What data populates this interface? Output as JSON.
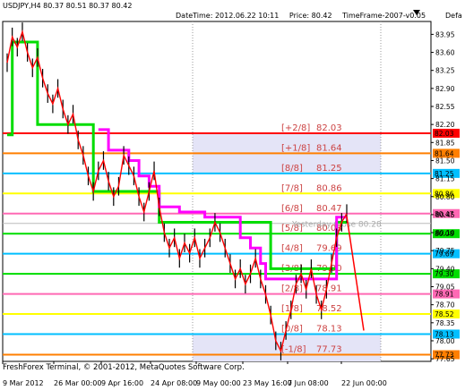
{
  "window": {
    "symbol_line": "USDJPY,H4  80.37 80.51 80.37 80.42",
    "datetime": "DateTime: 2012.06.22 10:11",
    "price": "Price: 80.42",
    "timeframe": "TimeFrame-2007-v0.05",
    "default_label": "Defa",
    "copyright": "FreshForex Terminal, © 2001-2012, MetaQuotes Software Corp."
  },
  "colors": {
    "background": "#ffffff",
    "price_line": "#000000",
    "trend_line": "#ff0000",
    "envelope_green": "#00dd00",
    "envelope_magenta": "#ff00ff",
    "zone_fill": "#e4e4f7"
  },
  "chart_data": {
    "type": "line",
    "ylim": [
      77.6,
      84.2
    ],
    "price_axis_ticks": [
      "83.95",
      "83.60",
      "83.25",
      "82.90",
      "82.55",
      "82.20",
      "81.85",
      "81.50",
      "81.15",
      "80.80",
      "80.45",
      "80.10",
      "79.75",
      "79.40",
      "79.05",
      "78.70",
      "78.35",
      "78.00",
      "77.65"
    ],
    "x_tick_labels": [
      "9 Mar 2012",
      "26 Mar 00:00",
      "9 Apr 16:00",
      "24 Apr 08:00",
      "9 May 00:00",
      "23 May 16:00",
      "7 Jun 08:00",
      "22 Jun 00:00"
    ],
    "murrey_levels": [
      {
        "label": "[+2/8]",
        "value": "82.03",
        "color": "#ff0000",
        "badge_text": "82.03"
      },
      {
        "label": "[+1/8]",
        "value": "81.64",
        "color": "#ff7f00",
        "badge_text": "81.64"
      },
      {
        "label": "[8/8]",
        "value": "81.25",
        "color": "#00bfff",
        "badge_text": "81.25"
      },
      {
        "label": "[7/8]",
        "value": "80.86",
        "color": "#ffff00",
        "badge_text": "80.86"
      },
      {
        "label": "[6/8]",
        "value": "80.47",
        "color": "#ff69b4",
        "badge_text": "80.47"
      },
      {
        "label": "[5/8]",
        "value": "80.08",
        "color": "#00dd00",
        "badge_text": "80.08"
      },
      {
        "label": "[4/8]",
        "value": "79.69",
        "color": "#00bfff",
        "badge_text": "79.69"
      },
      {
        "label": "[3/8]",
        "value": "79.30",
        "color": "#00dd00",
        "badge_text": "79.30"
      },
      {
        "label": "[2/8]",
        "value": "78.91",
        "color": "#ff69b4",
        "badge_text": "78.91"
      },
      {
        "label": "[1/8]",
        "value": "78.52",
        "color": "#ffff00",
        "badge_text": "78.52"
      },
      {
        "label": "[0/8]",
        "value": "78.13",
        "color": "#00bfff",
        "badge_text": "78.13"
      },
      {
        "label": "[-1/8]",
        "value": "77.73",
        "color": "#ff7f00",
        "badge_text": "77.73"
      }
    ],
    "yesterday_close": {
      "label": "Yesterday Close",
      "value": "80.28"
    },
    "current_price": 80.42,
    "price_series": [
      83.4,
      83.9,
      83.7,
      84.0,
      83.6,
      83.3,
      83.5,
      83.1,
      82.8,
      82.6,
      82.9,
      82.5,
      82.2,
      82.4,
      81.9,
      81.6,
      81.2,
      80.9,
      81.3,
      81.5,
      81.1,
      80.8,
      81.0,
      81.6,
      81.4,
      81.2,
      80.8,
      80.5,
      80.9,
      81.3,
      80.6,
      80.1,
      79.8,
      80.0,
      79.6,
      79.9,
      79.7,
      80.0,
      79.6,
      79.8,
      80.0,
      80.3,
      80.1,
      79.8,
      79.5,
      79.2,
      79.4,
      79.1,
      79.3,
      79.6,
      79.2,
      78.9,
      78.5,
      78.0,
      77.8,
      78.2,
      78.6,
      79.1,
      79.3,
      79.0,
      79.4,
      78.9,
      78.6,
      79.0,
      79.5,
      80.0,
      80.3,
      80.47
    ],
    "green_envelope": [
      82.0,
      83.8,
      83.8,
      83.8,
      83.8,
      83.8,
      82.2,
      82.2,
      82.2,
      82.2,
      82.2,
      82.2,
      82.2,
      82.2,
      82.2,
      82.2,
      82.2,
      80.9,
      80.9,
      80.9,
      80.9,
      80.9,
      80.9,
      80.9,
      80.9,
      80.9,
      80.9,
      80.9,
      80.9,
      80.9,
      80.3,
      80.3,
      80.3,
      80.3,
      80.3,
      80.3,
      80.3,
      80.3,
      80.3,
      80.3,
      80.3,
      80.3,
      80.3,
      80.3,
      80.3,
      80.3,
      80.3,
      80.3,
      80.3,
      80.3,
      80.3,
      80.3,
      79.4,
      79.4,
      79.4,
      79.4,
      79.4,
      79.4,
      79.4,
      79.4,
      79.4,
      79.4,
      79.4,
      79.4,
      79.4,
      80.3,
      80.3,
      80.3
    ],
    "magenta_envelope": [
      null,
      null,
      null,
      null,
      null,
      null,
      null,
      null,
      null,
      null,
      null,
      null,
      null,
      null,
      null,
      null,
      null,
      null,
      82.1,
      82.1,
      81.7,
      81.7,
      81.7,
      81.7,
      81.5,
      81.5,
      81.2,
      81.2,
      81.0,
      81.0,
      80.6,
      80.6,
      80.6,
      80.6,
      80.5,
      80.5,
      80.5,
      80.5,
      80.5,
      80.4,
      80.4,
      80.4,
      80.4,
      80.4,
      80.4,
      80.4,
      80.0,
      80.0,
      79.8,
      79.8,
      79.5,
      79.2,
      79.2,
      79.2,
      79.2,
      79.2,
      79.2,
      79.2,
      79.2,
      79.2,
      79.2,
      79.2,
      79.2,
      79.2,
      79.2,
      80.4,
      80.4,
      80.4
    ],
    "projection": {
      "from": 80.42,
      "to": 78.2
    }
  }
}
